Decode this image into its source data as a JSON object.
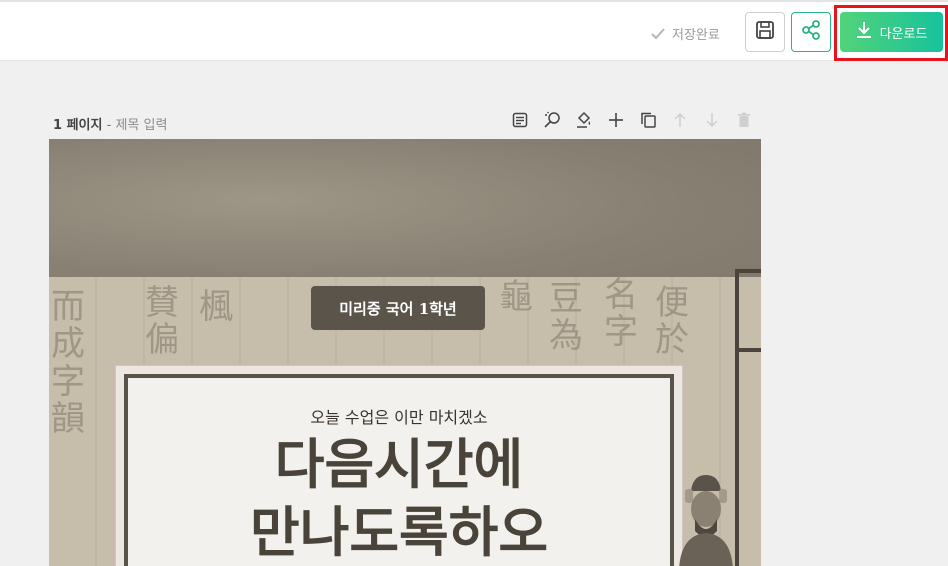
{
  "header": {
    "save_status": "저장완료",
    "download_label": "다운로드"
  },
  "page": {
    "number": "1 페이지",
    "separator": "-",
    "title_placeholder": "제목 입력"
  },
  "toolbar": {
    "icons": [
      "notes-icon",
      "magic-search-icon",
      "paint-bucket-icon",
      "plus-icon",
      "copy-icon",
      "arrow-up-icon",
      "arrow-down-icon",
      "trash-icon"
    ]
  },
  "canvas": {
    "subtitle": "미리중 국어 1학년",
    "lead": "오늘 수업은 이만 마치겠소",
    "headline_line1": "다음시간에",
    "headline_line2": "만나도록하오"
  },
  "colors": {
    "accent_green": "#27b57f",
    "download_gradient_start": "#52d37a",
    "download_gradient_end": "#17c29c",
    "highlight_red": "#e8141b"
  }
}
